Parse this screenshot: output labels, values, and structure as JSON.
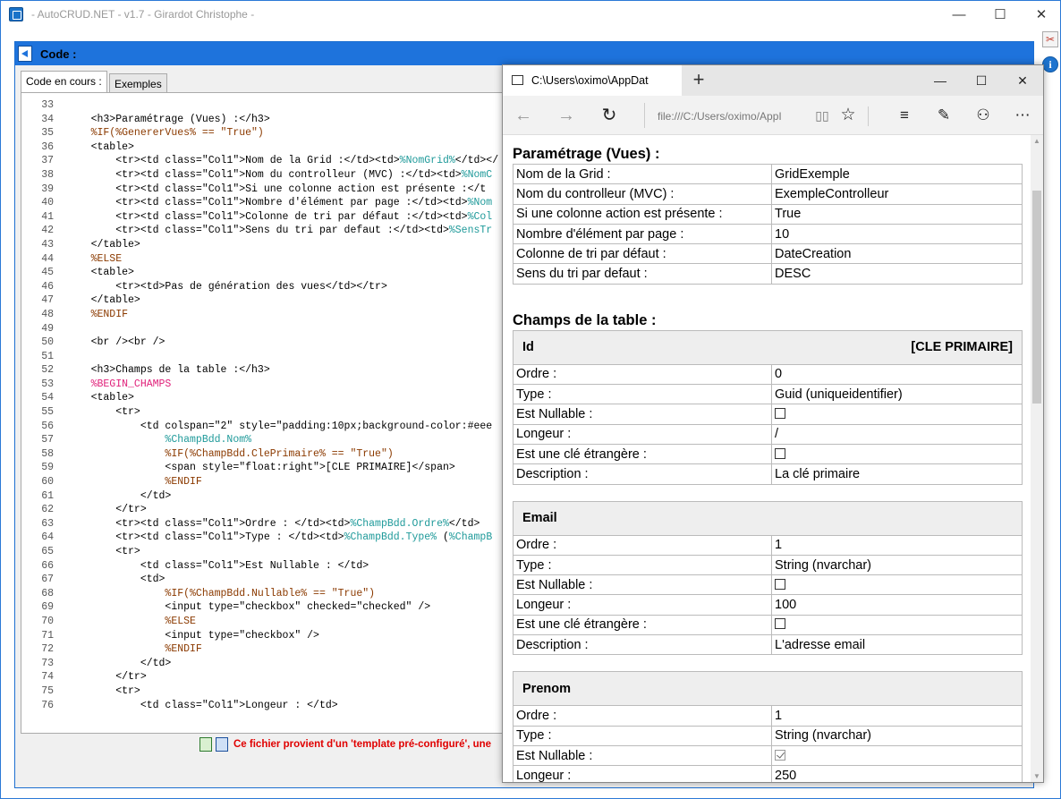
{
  "window": {
    "title": "- AutoCRUD.NET - v1.7 - Girardot Christophe -",
    "minimize": "—",
    "maximize": "☐",
    "close": "✕"
  },
  "side_tools": {
    "tools_icon": "✂",
    "info_icon": "i"
  },
  "code_panel": {
    "title": "Code :",
    "tabs": [
      {
        "label": "Code en cours :"
      },
      {
        "label": "Exemples"
      }
    ],
    "status_text": "Ce fichier provient d'un 'template pré-configuré', une",
    "lines": [
      {
        "n": "33",
        "segs": [
          {
            "t": "",
            "c": ""
          }
        ]
      },
      {
        "n": "34",
        "segs": [
          {
            "t": "    <h3>Paramétrage (Vues) :</h3>",
            "c": ""
          }
        ]
      },
      {
        "n": "35",
        "segs": [
          {
            "t": "    %IF(%GenererVues% == \"True\")",
            "c": "ck"
          }
        ]
      },
      {
        "n": "36",
        "segs": [
          {
            "t": "    <table>",
            "c": ""
          }
        ]
      },
      {
        "n": "37",
        "segs": [
          {
            "t": "        <tr><td class=\"Col1\">Nom de la Grid :</td><td>",
            "c": ""
          },
          {
            "t": "%NomGrid%",
            "c": "ct"
          },
          {
            "t": "</td></",
            "c": ""
          }
        ]
      },
      {
        "n": "38",
        "segs": [
          {
            "t": "        <tr><td class=\"Col1\">Nom du controlleur (MVC) :</td><td>",
            "c": ""
          },
          {
            "t": "%NomC",
            "c": "ct"
          }
        ]
      },
      {
        "n": "39",
        "segs": [
          {
            "t": "        <tr><td class=\"Col1\">Si une colonne action est présente :</t",
            "c": ""
          }
        ]
      },
      {
        "n": "40",
        "segs": [
          {
            "t": "        <tr><td class=\"Col1\">Nombre d'élément par page :</td><td>",
            "c": ""
          },
          {
            "t": "%Nom",
            "c": "ct"
          }
        ]
      },
      {
        "n": "41",
        "segs": [
          {
            "t": "        <tr><td class=\"Col1\">Colonne de tri par défaut :</td><td>",
            "c": ""
          },
          {
            "t": "%Col",
            "c": "ct"
          }
        ]
      },
      {
        "n": "42",
        "segs": [
          {
            "t": "        <tr><td class=\"Col1\">Sens du tri par defaut :</td><td>",
            "c": ""
          },
          {
            "t": "%SensTr",
            "c": "ct"
          }
        ]
      },
      {
        "n": "43",
        "segs": [
          {
            "t": "    </table>",
            "c": ""
          }
        ]
      },
      {
        "n": "44",
        "segs": [
          {
            "t": "    %ELSE",
            "c": "ck"
          }
        ]
      },
      {
        "n": "45",
        "segs": [
          {
            "t": "    <table>",
            "c": ""
          }
        ]
      },
      {
        "n": "46",
        "segs": [
          {
            "t": "        <tr><td>Pas de génération des vues</td></tr>",
            "c": ""
          }
        ]
      },
      {
        "n": "47",
        "segs": [
          {
            "t": "    </table>",
            "c": ""
          }
        ]
      },
      {
        "n": "48",
        "segs": [
          {
            "t": "    %ENDIF",
            "c": "ck"
          }
        ]
      },
      {
        "n": "49",
        "segs": [
          {
            "t": "",
            "c": ""
          }
        ]
      },
      {
        "n": "50",
        "segs": [
          {
            "t": "    <br /><br />",
            "c": ""
          }
        ]
      },
      {
        "n": "51",
        "segs": [
          {
            "t": "",
            "c": ""
          }
        ]
      },
      {
        "n": "52",
        "segs": [
          {
            "t": "    <h3>Champs de la table :</h3>",
            "c": ""
          }
        ]
      },
      {
        "n": "53",
        "segs": [
          {
            "t": "    %BEGIN_CHAMPS",
            "c": "cm"
          }
        ]
      },
      {
        "n": "54",
        "segs": [
          {
            "t": "    <table>",
            "c": ""
          }
        ]
      },
      {
        "n": "55",
        "segs": [
          {
            "t": "        <tr>",
            "c": ""
          }
        ]
      },
      {
        "n": "56",
        "segs": [
          {
            "t": "            <td colspan=\"2\" style=\"padding:10px;background-color:#eee",
            "c": ""
          }
        ]
      },
      {
        "n": "57",
        "segs": [
          {
            "t": "                %ChampBdd.Nom%",
            "c": "ct"
          }
        ]
      },
      {
        "n": "58",
        "segs": [
          {
            "t": "                %IF(%ChampBdd.ClePrimaire% == \"True\")",
            "c": "ck"
          }
        ]
      },
      {
        "n": "59",
        "segs": [
          {
            "t": "                <span style=\"float:right\">[CLE PRIMAIRE]</span>",
            "c": ""
          }
        ]
      },
      {
        "n": "60",
        "segs": [
          {
            "t": "                %ENDIF",
            "c": "ck"
          }
        ]
      },
      {
        "n": "61",
        "segs": [
          {
            "t": "            </td>",
            "c": ""
          }
        ]
      },
      {
        "n": "62",
        "segs": [
          {
            "t": "        </tr>",
            "c": ""
          }
        ]
      },
      {
        "n": "63",
        "segs": [
          {
            "t": "        <tr><td class=\"Col1\">Ordre : </td><td>",
            "c": ""
          },
          {
            "t": "%ChampBdd.Ordre%",
            "c": "ct"
          },
          {
            "t": "</td>",
            "c": ""
          }
        ]
      },
      {
        "n": "64",
        "segs": [
          {
            "t": "        <tr><td class=\"Col1\">Type : </td><td>",
            "c": ""
          },
          {
            "t": "%ChampBdd.Type%",
            "c": "ct"
          },
          {
            "t": " (",
            "c": ""
          },
          {
            "t": "%ChampB",
            "c": "ct"
          }
        ]
      },
      {
        "n": "65",
        "segs": [
          {
            "t": "        <tr>",
            "c": ""
          }
        ]
      },
      {
        "n": "66",
        "segs": [
          {
            "t": "            <td class=\"Col1\">Est Nullable : </td>",
            "c": ""
          }
        ]
      },
      {
        "n": "67",
        "segs": [
          {
            "t": "            <td>",
            "c": ""
          }
        ]
      },
      {
        "n": "68",
        "segs": [
          {
            "t": "                %IF(%ChampBdd.Nullable% == \"True\")",
            "c": "ck"
          }
        ]
      },
      {
        "n": "69",
        "segs": [
          {
            "t": "                <input type=\"checkbox\" checked=\"checked\" />",
            "c": ""
          }
        ]
      },
      {
        "n": "70",
        "segs": [
          {
            "t": "                %ELSE",
            "c": "ck"
          }
        ]
      },
      {
        "n": "71",
        "segs": [
          {
            "t": "                <input type=\"checkbox\" />",
            "c": ""
          }
        ]
      },
      {
        "n": "72",
        "segs": [
          {
            "t": "                %ENDIF",
            "c": "ck"
          }
        ]
      },
      {
        "n": "73",
        "segs": [
          {
            "t": "            </td>",
            "c": ""
          }
        ]
      },
      {
        "n": "74",
        "segs": [
          {
            "t": "        </tr>",
            "c": ""
          }
        ]
      },
      {
        "n": "75",
        "segs": [
          {
            "t": "        <tr>",
            "c": ""
          }
        ]
      },
      {
        "n": "76",
        "segs": [
          {
            "t": "            <td class=\"Col1\">Longeur : </td>",
            "c": ""
          }
        ]
      }
    ]
  },
  "browser": {
    "tab_title": "C:\\Users\\oximo\\AppDat",
    "new_tab": "+",
    "address": "file:///C:/Users/oximo/AppI",
    "minimize": "—",
    "maximize": "☐",
    "close": "✕",
    "page": {
      "settings_heading": "Paramétrage (Vues) :",
      "settings": [
        {
          "label": "Nom de la Grid :",
          "value": "GridExemple"
        },
        {
          "label": "Nom du controlleur (MVC) :",
          "value": "ExempleControlleur"
        },
        {
          "label": "Si une colonne action est présente :",
          "value": "True"
        },
        {
          "label": "Nombre d'élément par page :",
          "value": "10"
        },
        {
          "label": "Colonne de tri par défaut :",
          "value": "DateCreation"
        },
        {
          "label": "Sens du tri par defaut :",
          "value": "DESC"
        }
      ],
      "fields_heading": "Champs de la table :",
      "fields": [
        {
          "name": "Id",
          "primary_key": "[CLE PRIMAIRE]",
          "rows": [
            {
              "label": "Ordre :",
              "value": "0"
            },
            {
              "label": "Type :",
              "value": "Guid (uniqueidentifier)"
            },
            {
              "label": "Est Nullable :",
              "checkbox": false
            },
            {
              "label": "Longeur :",
              "value": "/"
            },
            {
              "label": "Est une clé étrangère :",
              "checkbox": false
            },
            {
              "label": "Description :",
              "value": "La clé primaire"
            }
          ]
        },
        {
          "name": "Email",
          "primary_key": "",
          "rows": [
            {
              "label": "Ordre :",
              "value": "1"
            },
            {
              "label": "Type :",
              "value": "String (nvarchar)"
            },
            {
              "label": "Est Nullable :",
              "checkbox": false
            },
            {
              "label": "Longeur :",
              "value": "100"
            },
            {
              "label": "Est une clé étrangère :",
              "checkbox": false
            },
            {
              "label": "Description :",
              "value": "L'adresse email"
            }
          ]
        },
        {
          "name": "Prenom",
          "primary_key": "",
          "rows": [
            {
              "label": "Ordre :",
              "value": "1"
            },
            {
              "label": "Type :",
              "value": "String (nvarchar)"
            },
            {
              "label": "Est Nullable :",
              "checkbox": true
            },
            {
              "label": "Longeur :",
              "value": "250"
            }
          ]
        }
      ]
    }
  }
}
